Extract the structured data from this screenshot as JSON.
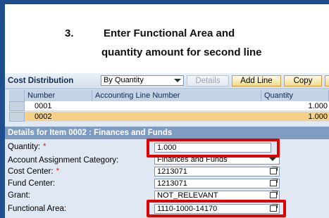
{
  "instruction": {
    "step_number": "3.",
    "line1": "Enter Functional Area and",
    "line2": "quantity amount for second line"
  },
  "toolbar": {
    "title": "Cost Distribution",
    "distribution_select": "By Quantity",
    "details_label": "Details",
    "add_line_label": "Add Line",
    "copy_label": "Copy"
  },
  "grid": {
    "columns": [
      "Number",
      "Accounting Line Number",
      "Quantity"
    ],
    "rows": [
      {
        "number": "0001",
        "accounting_line": "",
        "quantity": "1.000"
      },
      {
        "number": "0002",
        "accounting_line": "",
        "quantity": "1.000"
      }
    ]
  },
  "details": {
    "header": "Details for Item 0002 : Finances and Funds",
    "fields": {
      "quantity_label": "Quantity:",
      "quantity_value": "1.000",
      "aac_label": "Account Assignment Category:",
      "aac_value": "Finances and Funds",
      "cost_center_label": "Cost Center:",
      "cost_center_value": "1213071",
      "fund_center_label": "Fund Center:",
      "fund_center_value": "1213071",
      "grant_label": "Grant:",
      "grant_value": "NOT_RELEVANT",
      "functional_area_label": "Functional Area:",
      "functional_area_value": "1110-1000-14170"
    },
    "required_marker": "*"
  },
  "colors": {
    "frame": "#1f4e8f",
    "highlight": "#e00000",
    "selected_row": "#f6d087",
    "details_bar": "#7f9cc2"
  }
}
